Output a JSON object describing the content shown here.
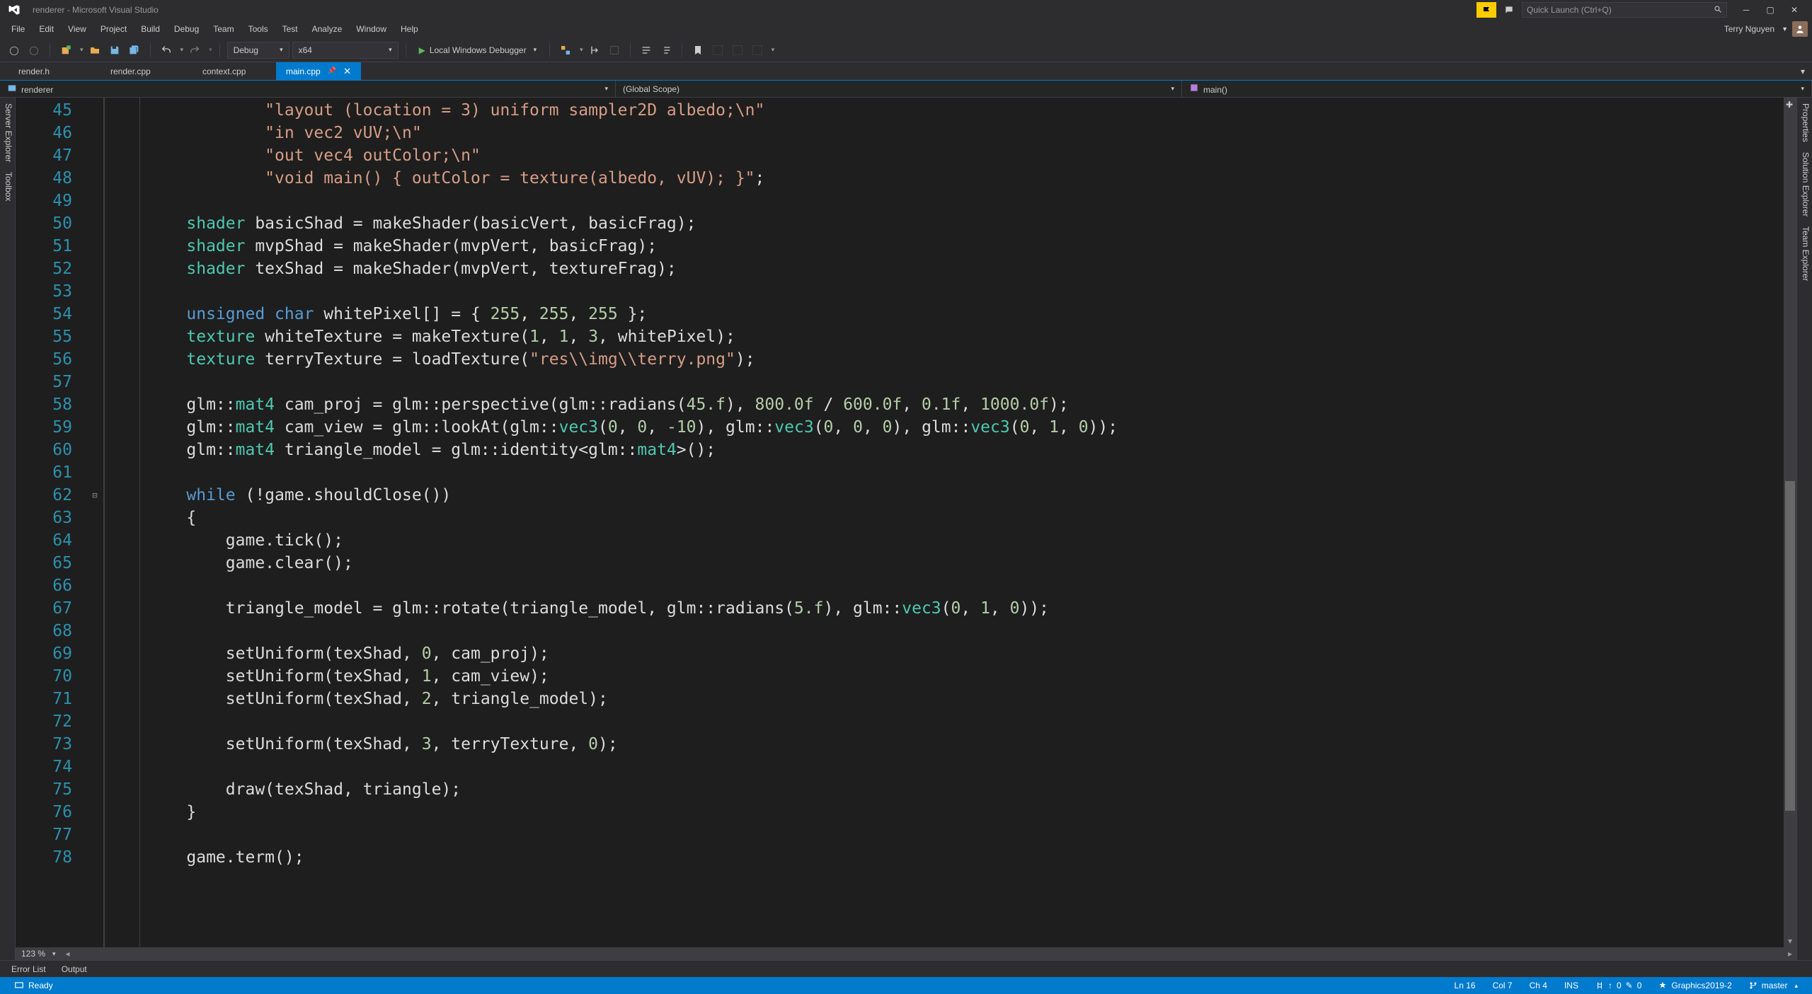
{
  "title": "renderer - Microsoft Visual Studio",
  "quick_launch_placeholder": "Quick Launch (Ctrl+Q)",
  "menu": [
    "File",
    "Edit",
    "View",
    "Project",
    "Build",
    "Debug",
    "Team",
    "Tools",
    "Test",
    "Analyze",
    "Window",
    "Help"
  ],
  "user_name": "Terry Nguyen",
  "toolbar": {
    "config": "Debug",
    "platform": "x64",
    "debugger": "Local Windows Debugger"
  },
  "tabs": [
    {
      "label": "render.h",
      "active": false
    },
    {
      "label": "render.cpp",
      "active": false
    },
    {
      "label": "context.cpp",
      "active": false
    },
    {
      "label": "main.cpp",
      "active": true
    }
  ],
  "nav": {
    "project": "renderer",
    "scope": "(Global Scope)",
    "function": "main()"
  },
  "side_left": [
    "Server Explorer",
    "Toolbox"
  ],
  "side_right": [
    "Properties",
    "Solution Explorer",
    "Team Explorer"
  ],
  "editor": {
    "first_line": 45,
    "zoom": "123 %",
    "lines": [
      [
        {
          "t": "            ",
          "c": ""
        },
        {
          "t": "\"layout (location = 3) uniform sampler2D albedo;\\n\"",
          "c": "tok-str"
        }
      ],
      [
        {
          "t": "            ",
          "c": ""
        },
        {
          "t": "\"in vec2 vUV;\\n\"",
          "c": "tok-str"
        }
      ],
      [
        {
          "t": "            ",
          "c": ""
        },
        {
          "t": "\"out vec4 outColor;\\n\"",
          "c": "tok-str"
        }
      ],
      [
        {
          "t": "            ",
          "c": ""
        },
        {
          "t": "\"void main() { outColor = texture(albedo, vUV); }\"",
          "c": "tok-str"
        },
        {
          "t": ";",
          "c": ""
        }
      ],
      [],
      [
        {
          "t": "    ",
          "c": ""
        },
        {
          "t": "shader",
          "c": "tok-type"
        },
        {
          "t": " basicShad = makeShader(basicVert, basicFrag);",
          "c": ""
        }
      ],
      [
        {
          "t": "    ",
          "c": ""
        },
        {
          "t": "shader",
          "c": "tok-type"
        },
        {
          "t": " mvpShad = makeShader(mvpVert, basicFrag);",
          "c": ""
        }
      ],
      [
        {
          "t": "    ",
          "c": ""
        },
        {
          "t": "shader",
          "c": "tok-type"
        },
        {
          "t": " texShad = makeShader(mvpVert, textureFrag);",
          "c": ""
        }
      ],
      [],
      [
        {
          "t": "    ",
          "c": ""
        },
        {
          "t": "unsigned",
          "c": "tok-kw"
        },
        {
          "t": " ",
          "c": ""
        },
        {
          "t": "char",
          "c": "tok-kw"
        },
        {
          "t": " whitePixel[] = { ",
          "c": ""
        },
        {
          "t": "255",
          "c": "tok-num"
        },
        {
          "t": ", ",
          "c": ""
        },
        {
          "t": "255",
          "c": "tok-num"
        },
        {
          "t": ", ",
          "c": ""
        },
        {
          "t": "255",
          "c": "tok-num"
        },
        {
          "t": " };",
          "c": ""
        }
      ],
      [
        {
          "t": "    ",
          "c": ""
        },
        {
          "t": "texture",
          "c": "tok-type"
        },
        {
          "t": " whiteTexture = makeTexture(",
          "c": ""
        },
        {
          "t": "1",
          "c": "tok-num"
        },
        {
          "t": ", ",
          "c": ""
        },
        {
          "t": "1",
          "c": "tok-num"
        },
        {
          "t": ", ",
          "c": ""
        },
        {
          "t": "3",
          "c": "tok-num"
        },
        {
          "t": ", whitePixel);",
          "c": ""
        }
      ],
      [
        {
          "t": "    ",
          "c": ""
        },
        {
          "t": "texture",
          "c": "tok-type"
        },
        {
          "t": " terryTexture = loadTexture(",
          "c": ""
        },
        {
          "t": "\"res\\\\img\\\\terry.png\"",
          "c": "tok-str"
        },
        {
          "t": ");",
          "c": ""
        }
      ],
      [],
      [
        {
          "t": "    glm::",
          "c": ""
        },
        {
          "t": "mat4",
          "c": "tok-type"
        },
        {
          "t": " cam_proj = glm::perspective(glm::radians(",
          "c": ""
        },
        {
          "t": "45.f",
          "c": "tok-num"
        },
        {
          "t": "), ",
          "c": ""
        },
        {
          "t": "800.0f",
          "c": "tok-num"
        },
        {
          "t": " / ",
          "c": ""
        },
        {
          "t": "600.0f",
          "c": "tok-num"
        },
        {
          "t": ", ",
          "c": ""
        },
        {
          "t": "0.1f",
          "c": "tok-num"
        },
        {
          "t": ", ",
          "c": ""
        },
        {
          "t": "1000.0f",
          "c": "tok-num"
        },
        {
          "t": ");",
          "c": ""
        }
      ],
      [
        {
          "t": "    glm::",
          "c": ""
        },
        {
          "t": "mat4",
          "c": "tok-type"
        },
        {
          "t": " cam_view = glm::lookAt(glm::",
          "c": ""
        },
        {
          "t": "vec3",
          "c": "tok-type"
        },
        {
          "t": "(",
          "c": ""
        },
        {
          "t": "0",
          "c": "tok-num"
        },
        {
          "t": ", ",
          "c": ""
        },
        {
          "t": "0",
          "c": "tok-num"
        },
        {
          "t": ", ",
          "c": ""
        },
        {
          "t": "-10",
          "c": "tok-num"
        },
        {
          "t": "), glm::",
          "c": ""
        },
        {
          "t": "vec3",
          "c": "tok-type"
        },
        {
          "t": "(",
          "c": ""
        },
        {
          "t": "0",
          "c": "tok-num"
        },
        {
          "t": ", ",
          "c": ""
        },
        {
          "t": "0",
          "c": "tok-num"
        },
        {
          "t": ", ",
          "c": ""
        },
        {
          "t": "0",
          "c": "tok-num"
        },
        {
          "t": "), glm::",
          "c": ""
        },
        {
          "t": "vec3",
          "c": "tok-type"
        },
        {
          "t": "(",
          "c": ""
        },
        {
          "t": "0",
          "c": "tok-num"
        },
        {
          "t": ", ",
          "c": ""
        },
        {
          "t": "1",
          "c": "tok-num"
        },
        {
          "t": ", ",
          "c": ""
        },
        {
          "t": "0",
          "c": "tok-num"
        },
        {
          "t": "));",
          "c": ""
        }
      ],
      [
        {
          "t": "    glm::",
          "c": ""
        },
        {
          "t": "mat4",
          "c": "tok-type"
        },
        {
          "t": " triangle_model = glm::identity<glm::",
          "c": ""
        },
        {
          "t": "mat4",
          "c": "tok-type"
        },
        {
          "t": ">();",
          "c": ""
        }
      ],
      [],
      [
        {
          "t": "    ",
          "c": ""
        },
        {
          "t": "while",
          "c": "tok-kw"
        },
        {
          "t": " (!game.shouldClose())",
          "c": ""
        }
      ],
      [
        {
          "t": "    {",
          "c": ""
        }
      ],
      [
        {
          "t": "        game.tick();",
          "c": ""
        }
      ],
      [
        {
          "t": "        game.clear();",
          "c": ""
        }
      ],
      [],
      [
        {
          "t": "        triangle_model = glm::rotate(triangle_model, glm::radians(",
          "c": ""
        },
        {
          "t": "5.f",
          "c": "tok-num"
        },
        {
          "t": "), glm::",
          "c": ""
        },
        {
          "t": "vec3",
          "c": "tok-type"
        },
        {
          "t": "(",
          "c": ""
        },
        {
          "t": "0",
          "c": "tok-num"
        },
        {
          "t": ", ",
          "c": ""
        },
        {
          "t": "1",
          "c": "tok-num"
        },
        {
          "t": ", ",
          "c": ""
        },
        {
          "t": "0",
          "c": "tok-num"
        },
        {
          "t": "));",
          "c": ""
        }
      ],
      [],
      [
        {
          "t": "        setUniform(texShad, ",
          "c": ""
        },
        {
          "t": "0",
          "c": "tok-num"
        },
        {
          "t": ", cam_proj);",
          "c": ""
        }
      ],
      [
        {
          "t": "        setUniform(texShad, ",
          "c": ""
        },
        {
          "t": "1",
          "c": "tok-num"
        },
        {
          "t": ", cam_view);",
          "c": ""
        }
      ],
      [
        {
          "t": "        setUniform(texShad, ",
          "c": ""
        },
        {
          "t": "2",
          "c": "tok-num"
        },
        {
          "t": ", triangle_model);",
          "c": ""
        }
      ],
      [],
      [
        {
          "t": "        setUniform(texShad, ",
          "c": ""
        },
        {
          "t": "3",
          "c": "tok-num"
        },
        {
          "t": ", terryTexture, ",
          "c": ""
        },
        {
          "t": "0",
          "c": "tok-num"
        },
        {
          "t": ");",
          "c": ""
        }
      ],
      [],
      [
        {
          "t": "        draw(texShad, triangle);",
          "c": ""
        }
      ],
      [
        {
          "t": "    }",
          "c": ""
        }
      ],
      [],
      [
        {
          "t": "    game.term();",
          "c": ""
        }
      ]
    ],
    "fold_rows": {
      "17": "⊟"
    }
  },
  "bottom_tabs": [
    "Error List",
    "Output"
  ],
  "status": {
    "ready": "Ready",
    "ln": "Ln 16",
    "col": "Col 7",
    "ch": "Ch 4",
    "ins": "INS",
    "pr_up": "0",
    "pr_down": "0",
    "repo": "Graphics2019-2",
    "branch": "master"
  }
}
